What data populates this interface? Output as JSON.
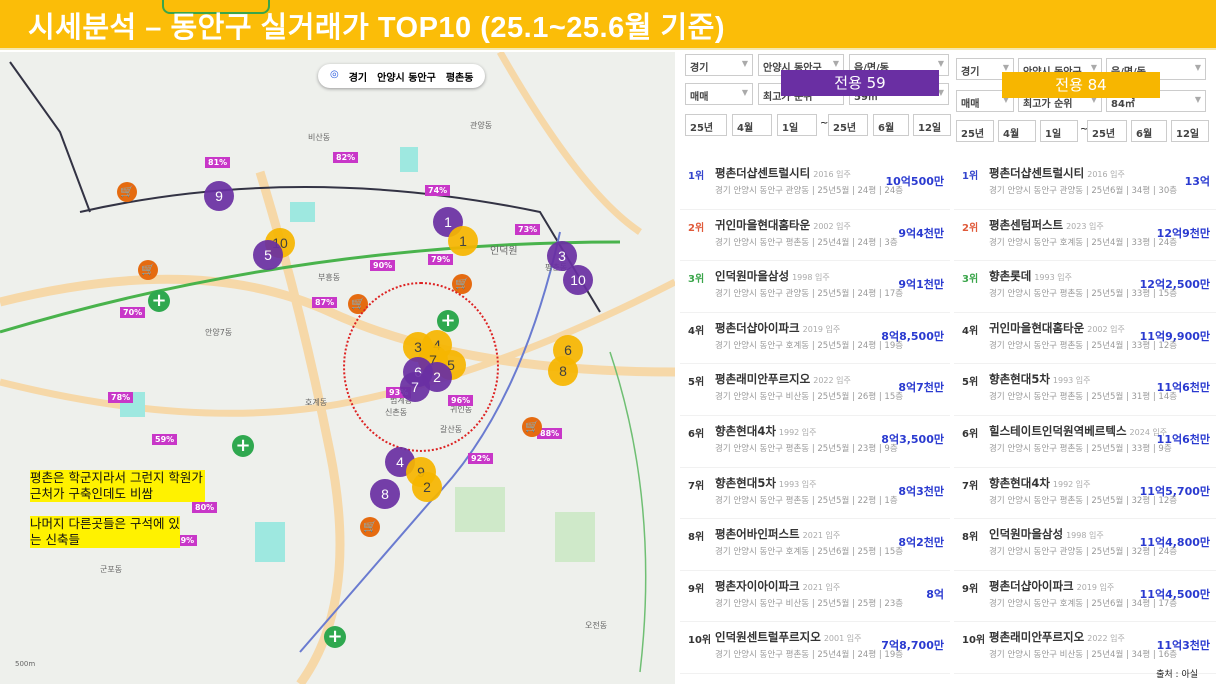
{
  "title": "시세분석 – 동안구 실거래가 TOP10 (25.1~25.6월 기준)",
  "map": {
    "location": [
      "경기",
      "안양시 동안구",
      "평촌동"
    ],
    "notes": [
      "평촌은 학군지라서 그런지 학원가 근처가 구축인데도 비쌈",
      "나머지 다른곳들은 구석에 있는 신축들"
    ],
    "labels": [
      "관양동",
      "인덕원",
      "비산동",
      "평촌동",
      "귀인동",
      "호계동",
      "갈산동",
      "안양7동",
      "부흥동",
      "신촌동",
      "범계동",
      "오전동",
      "군포동",
      "500m"
    ],
    "percents": [
      "81%",
      "82%",
      "74%",
      "73%",
      "90%",
      "79%",
      "87%",
      "93%",
      "96%",
      "92%",
      "88%",
      "80%",
      "89%",
      "70%",
      "78%",
      "59%"
    ],
    "markers_59": [
      "1",
      "2",
      "3",
      "4",
      "5",
      "6",
      "7",
      "8",
      "9",
      "10"
    ],
    "markers_84": [
      "1",
      "2",
      "3",
      "4",
      "5",
      "6",
      "7",
      "8",
      "9",
      "10"
    ]
  },
  "panel59": {
    "badge": "전용 59",
    "filters": {
      "r1": [
        "경기",
        "안양시 동안구",
        "읍/면/동"
      ],
      "r2": [
        "매매",
        "최고가 순위",
        "59㎡"
      ],
      "r3": [
        "25년",
        "4월",
        "1일",
        "~",
        "25년",
        "6월",
        "12일"
      ]
    },
    "items": [
      {
        "rank": "1위",
        "name": "평촌더샵센트럴시티",
        "year": "2016 입주",
        "sub": "경기 안양시 동안구 관양동 | 25년5월 | 24평 | 24층",
        "price": "10억500만"
      },
      {
        "rank": "2위",
        "name": "귀인마을현대홈타운",
        "year": "2002 입주",
        "sub": "경기 안양시 동안구 평촌동 | 25년4월 | 24평 | 3층",
        "price": "9억4천만"
      },
      {
        "rank": "3위",
        "name": "인덕원마을삼성",
        "year": "1998 입주",
        "sub": "경기 안양시 동안구 관양동 | 25년5월 | 24평 | 17층",
        "price": "9억1천만"
      },
      {
        "rank": "4위",
        "name": "평촌더샵아이파크",
        "year": "2019 입주",
        "sub": "경기 안양시 동안구 호계동 | 25년5월 | 24평 | 19층",
        "price": "8억8,500만"
      },
      {
        "rank": "5위",
        "name": "평촌래미안푸르지오",
        "year": "2022 입주",
        "sub": "경기 안양시 동안구 비산동 | 25년5월 | 26평 | 15층",
        "price": "8억7천만"
      },
      {
        "rank": "6위",
        "name": "향촌현대4차",
        "year": "1992 입주",
        "sub": "경기 안양시 동안구 평촌동 | 25년5월 | 23평 | 9층",
        "price": "8억3,500만"
      },
      {
        "rank": "7위",
        "name": "향촌현대5차",
        "year": "1993 입주",
        "sub": "경기 안양시 동안구 평촌동 | 25년5월 | 22평 | 1층",
        "price": "8억3천만"
      },
      {
        "rank": "8위",
        "name": "평촌어바인퍼스트",
        "year": "2021 입주",
        "sub": "경기 안양시 동안구 호계동 | 25년6월 | 25평 | 15층",
        "price": "8억2천만"
      },
      {
        "rank": "9위",
        "name": "평촌자이아이파크",
        "year": "2021 입주",
        "sub": "경기 안양시 동안구 비산동 | 25년5월 | 25평 | 23층",
        "price": "8억"
      },
      {
        "rank": "10위",
        "name": "인덕원센트럴푸르지오",
        "year": "2001 입주",
        "sub": "경기 안양시 동안구 평촌동 | 25년4월 | 24평 | 19층",
        "price": "7억8,700만"
      }
    ]
  },
  "panel84": {
    "badge": "전용 84",
    "filters": {
      "r1": [
        "경기",
        "안양시 동안구",
        "읍/면/동"
      ],
      "r2": [
        "매매",
        "최고가 순위",
        "84㎡"
      ],
      "r3": [
        "25년",
        "4월",
        "1일",
        "~",
        "25년",
        "6월",
        "12일"
      ]
    },
    "items": [
      {
        "rank": "1위",
        "name": "평촌더샵센트럴시티",
        "year": "2016 입주",
        "sub": "경기 안양시 동안구 관양동 | 25년6월 | 34평 | 30층",
        "price": "13억"
      },
      {
        "rank": "2위",
        "name": "평촌센텀퍼스트",
        "year": "2023 입주",
        "sub": "경기 안양시 동안구 호계동 | 25년4월 | 33평 | 24층",
        "price": "12억9천만"
      },
      {
        "rank": "3위",
        "name": "향촌롯데",
        "year": "1993 입주",
        "sub": "경기 안양시 동안구 평촌동 | 25년5월 | 33평 | 15층",
        "price": "12억2,500만"
      },
      {
        "rank": "4위",
        "name": "귀인마을현대홈타운",
        "year": "2002 입주",
        "sub": "경기 안양시 동안구 평촌동 | 25년4월 | 33평 | 12층",
        "price": "11억9,900만"
      },
      {
        "rank": "5위",
        "name": "향촌현대5차",
        "year": "1993 입주",
        "sub": "경기 안양시 동안구 평촌동 | 25년5월 | 31평 | 14층",
        "price": "11억6천만"
      },
      {
        "rank": "6위",
        "name": "힐스테이트인덕원역베르텍스",
        "year": "2024 입주",
        "sub": "경기 안양시 동안구 평촌동 | 25년5월 | 33평 | 9층",
        "price": "11억6천만"
      },
      {
        "rank": "7위",
        "name": "향촌현대4차",
        "year": "1992 입주",
        "sub": "경기 안양시 동안구 평촌동 | 25년5월 | 32평 | 12층",
        "price": "11억5,700만"
      },
      {
        "rank": "8위",
        "name": "인덕원마을삼성",
        "year": "1998 입주",
        "sub": "경기 안양시 동안구 관양동 | 25년5월 | 32평 | 24층",
        "price": "11억4,800만"
      },
      {
        "rank": "9위",
        "name": "평촌더샵아이파크",
        "year": "2019 입주",
        "sub": "경기 안양시 동안구 호계동 | 25년6월 | 34평 | 17층",
        "price": "11억4,500만"
      },
      {
        "rank": "10위",
        "name": "평촌래미안푸르지오",
        "year": "2022 입주",
        "sub": "경기 안양시 동안구 비산동 | 25년4월 | 34평 | 16층",
        "price": "11억3천만"
      }
    ],
    "source": "출처 : 아실"
  },
  "colors": {
    "title_bg": "#fbbd08",
    "purple": "#6a2fa3",
    "yellow": "#f7b600",
    "price": "#2a3ad0",
    "rank1": "#3344cc",
    "rank2": "#e05a3a",
    "rank3": "#3aa54a"
  }
}
